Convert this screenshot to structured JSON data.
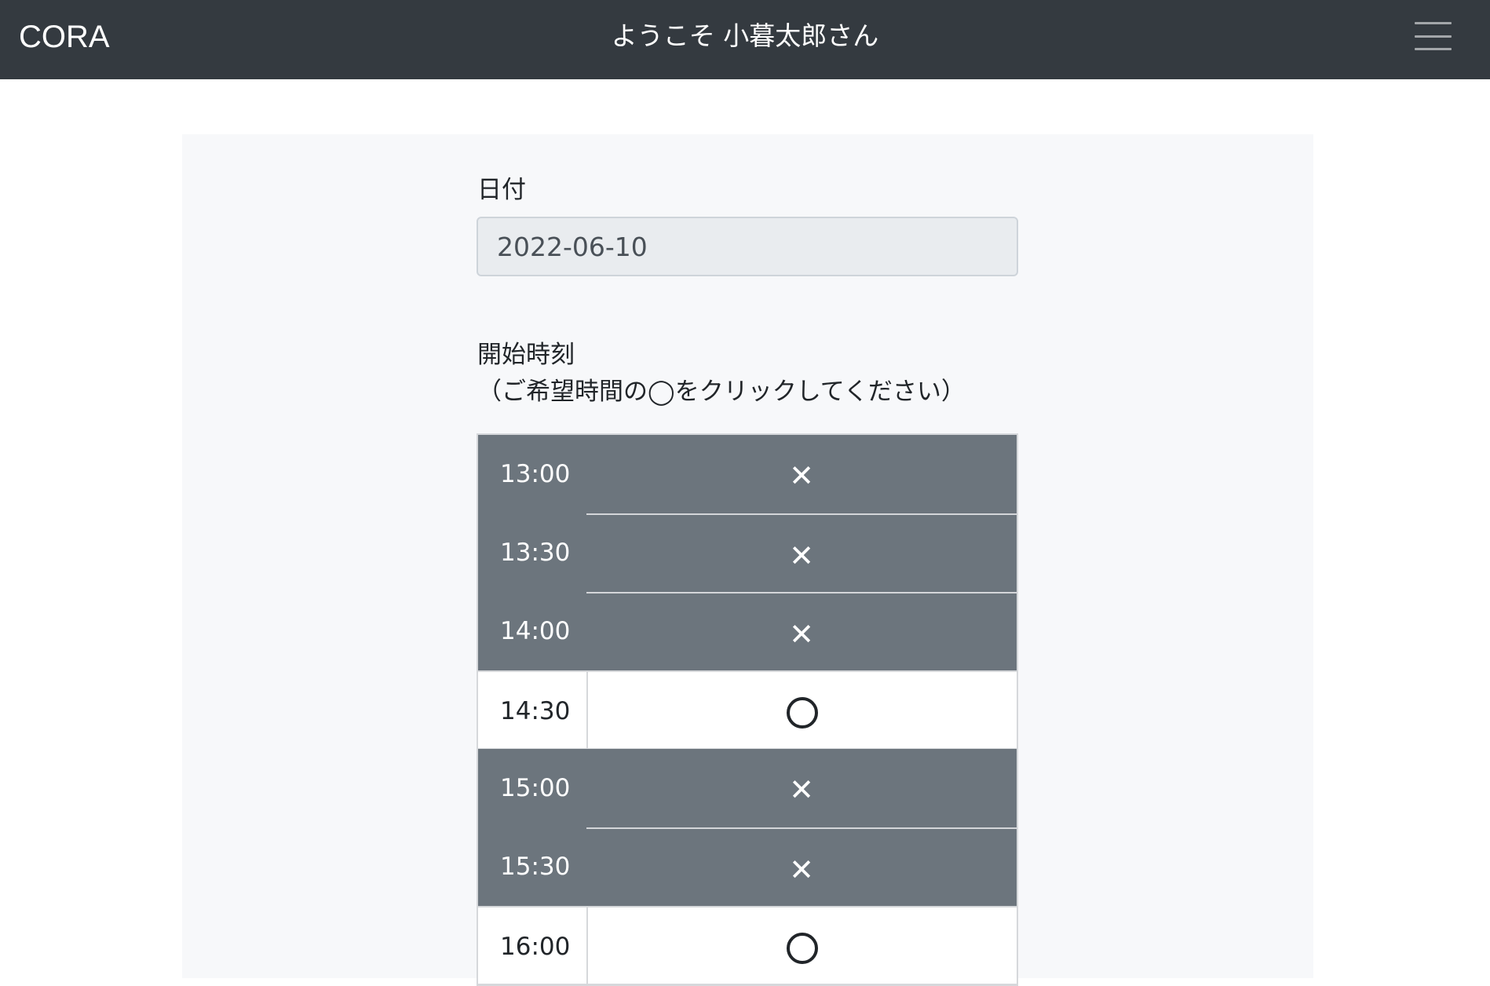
{
  "navbar": {
    "brand": "CORA",
    "welcome": "ようこそ 小暮太郎さん",
    "menu_icon": "hamburger-icon"
  },
  "form": {
    "date_label": "日付",
    "date_value": "2022-06-10",
    "start_time_label": "開始時刻",
    "start_time_hint": "（ご希望時間の◯をクリックしてください）"
  },
  "slots": [
    {
      "time": "13:00",
      "mark": "✕",
      "available": false
    },
    {
      "time": "13:30",
      "mark": "✕",
      "available": false
    },
    {
      "time": "14:00",
      "mark": "✕",
      "available": false
    },
    {
      "time": "14:30",
      "mark": "◯",
      "available": true
    },
    {
      "time": "15:00",
      "mark": "✕",
      "available": false
    },
    {
      "time": "15:30",
      "mark": "✕",
      "available": false
    },
    {
      "time": "16:00",
      "mark": "◯",
      "available": true
    }
  ],
  "colors": {
    "navbar_bg": "#343a40",
    "unavailable_bg": "#6c757d",
    "available_bg": "#ffffff",
    "panel_bg": "#f7f8fa"
  }
}
